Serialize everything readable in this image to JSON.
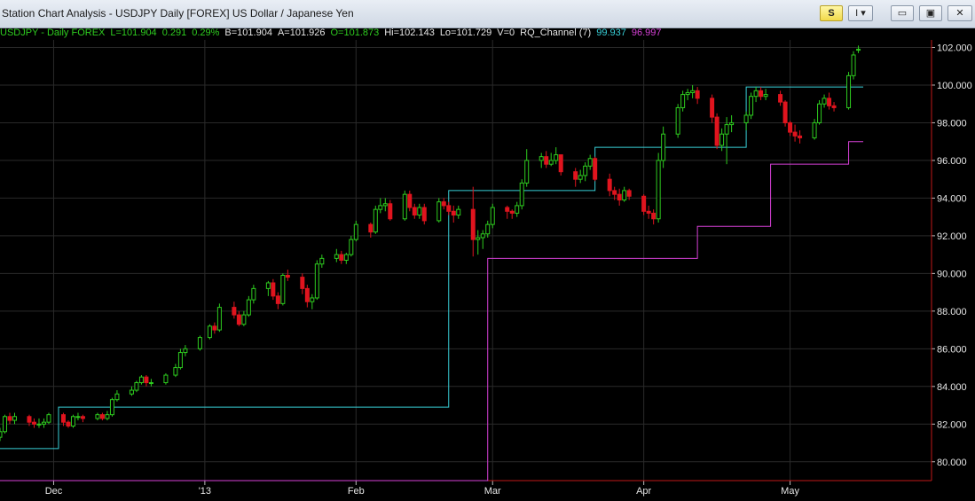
{
  "window": {
    "title": "Station Chart Analysis - USDJPY Daily [FOREX] US Dollar / Japanese Yen",
    "s_label": "S",
    "i_label": "I ▾",
    "min_label": "▭",
    "max_label": "▣",
    "close_label": "✕"
  },
  "legend": {
    "symbol": "USDJPY - Daily  FOREX",
    "last": "L=101.904",
    "change": "0.291",
    "pct": "0.29%",
    "bid": "B=101.904",
    "ask": "A=101.926",
    "open": "O=101.873",
    "high": "Hi=102.143",
    "low": "Lo=101.729",
    "vol": "V=0",
    "indicator": "RQ_Channel (7)",
    "upper_val": "99.937",
    "lower_val": "96.997"
  },
  "colors": {
    "up": "#2ecc1f",
    "down": "#e0141e",
    "upper": "#38d0d8",
    "lower": "#d640d6",
    "grid": "#2a2a2a",
    "axis": "#c01818"
  },
  "chart_data": {
    "type": "candlestick",
    "y_ticks": [
      "102.000",
      "100.000",
      "98.000",
      "96.000",
      "94.000",
      "92.000",
      "90.000",
      "88.000",
      "86.000",
      "84.000",
      "82.000",
      "80.000"
    ],
    "x_labels": [
      "Dec",
      "'13",
      "Feb",
      "Mar",
      "Apr",
      "May"
    ],
    "x_label_dates": [
      "2012-12-01",
      "2013-01-01",
      "2013-02-01",
      "2013-03-01",
      "2013-04-01",
      "2013-05-01"
    ],
    "x_range": [
      "2012-11-20",
      "2013-05-30"
    ],
    "ylim": [
      79.0,
      102.4
    ],
    "grid": true,
    "ohlc": [
      [
        "2012-11-20",
        81.3,
        81.8,
        81.1,
        81.6
      ],
      [
        "2012-11-21",
        81.6,
        82.5,
        81.5,
        82.4
      ],
      [
        "2012-11-22",
        82.4,
        82.6,
        82.0,
        82.2
      ],
      [
        "2012-11-23",
        82.2,
        82.6,
        82.0,
        82.4
      ],
      [
        "2012-11-26",
        82.4,
        82.5,
        81.9,
        82.1
      ],
      [
        "2012-11-27",
        82.1,
        82.3,
        81.8,
        82.0
      ],
      [
        "2012-11-28",
        82.0,
        82.3,
        81.8,
        82.0
      ],
      [
        "2012-11-29",
        82.0,
        82.3,
        81.8,
        82.1
      ],
      [
        "2012-11-30",
        82.1,
        82.6,
        82.0,
        82.5
      ],
      [
        "2012-12-03",
        82.5,
        82.6,
        81.9,
        82.1
      ],
      [
        "2012-12-04",
        82.1,
        82.2,
        81.8,
        81.9
      ],
      [
        "2012-12-05",
        81.9,
        82.5,
        81.8,
        82.4
      ],
      [
        "2012-12-06",
        82.4,
        82.6,
        82.2,
        82.4
      ],
      [
        "2012-12-07",
        82.4,
        82.5,
        82.1,
        82.3
      ],
      [
        "2012-12-10",
        82.3,
        82.6,
        82.2,
        82.5
      ],
      [
        "2012-12-11",
        82.5,
        82.6,
        82.2,
        82.3
      ],
      [
        "2012-12-12",
        82.3,
        82.7,
        82.2,
        82.5
      ],
      [
        "2012-12-13",
        82.5,
        83.4,
        82.4,
        83.3
      ],
      [
        "2012-12-14",
        83.3,
        83.8,
        83.2,
        83.6
      ],
      [
        "2012-12-17",
        83.6,
        84.0,
        83.5,
        83.8
      ],
      [
        "2012-12-18",
        83.8,
        84.3,
        83.7,
        84.2
      ],
      [
        "2012-12-19",
        84.2,
        84.6,
        84.1,
        84.5
      ],
      [
        "2012-12-20",
        84.5,
        84.6,
        84.0,
        84.2
      ],
      [
        "2012-12-21",
        84.2,
        84.4,
        84.0,
        84.2
      ],
      [
        "2012-12-24",
        84.2,
        84.7,
        84.1,
        84.6
      ],
      [
        "2012-12-26",
        84.6,
        85.2,
        84.5,
        85.0
      ],
      [
        "2012-12-27",
        85.0,
        86.0,
        84.9,
        85.8
      ],
      [
        "2012-12-28",
        85.8,
        86.2,
        85.6,
        86.0
      ],
      [
        "2012-12-31",
        86.0,
        86.7,
        85.9,
        86.6
      ],
      [
        "2013-01-02",
        86.6,
        87.3,
        86.5,
        87.2
      ],
      [
        "2013-01-03",
        87.2,
        87.4,
        86.8,
        87.0
      ],
      [
        "2013-01-04",
        87.0,
        88.4,
        86.9,
        88.2
      ],
      [
        "2013-01-07",
        88.2,
        88.5,
        87.6,
        87.8
      ],
      [
        "2013-01-08",
        87.8,
        88.0,
        87.2,
        87.3
      ],
      [
        "2013-01-09",
        87.3,
        88.0,
        87.2,
        87.8
      ],
      [
        "2013-01-10",
        87.8,
        88.8,
        87.7,
        88.6
      ],
      [
        "2013-01-11",
        88.6,
        89.4,
        88.4,
        89.2
      ],
      [
        "2013-01-14",
        89.2,
        89.6,
        88.8,
        89.5
      ],
      [
        "2013-01-15",
        89.5,
        89.7,
        88.6,
        88.8
      ],
      [
        "2013-01-16",
        88.8,
        89.0,
        88.1,
        88.4
      ],
      [
        "2013-01-17",
        88.4,
        90.0,
        88.3,
        89.9
      ],
      [
        "2013-01-18",
        89.9,
        90.2,
        89.6,
        89.8
      ],
      [
        "2013-01-21",
        89.8,
        90.0,
        88.9,
        89.2
      ],
      [
        "2013-01-22",
        89.2,
        89.4,
        88.2,
        88.5
      ],
      [
        "2013-01-23",
        88.5,
        88.9,
        88.1,
        88.7
      ],
      [
        "2013-01-24",
        88.7,
        90.7,
        88.6,
        90.5
      ],
      [
        "2013-01-25",
        90.5,
        91.0,
        90.3,
        90.8
      ],
      [
        "2013-01-28",
        90.8,
        91.3,
        90.6,
        91.0
      ],
      [
        "2013-01-29",
        91.0,
        91.2,
        90.5,
        90.7
      ],
      [
        "2013-01-30",
        90.7,
        91.1,
        90.5,
        91.0
      ],
      [
        "2013-01-31",
        91.0,
        92.0,
        90.9,
        91.8
      ],
      [
        "2013-02-01",
        91.8,
        92.8,
        91.7,
        92.6
      ],
      [
        "2013-02-04",
        92.6,
        92.7,
        91.9,
        92.2
      ],
      [
        "2013-02-05",
        92.2,
        93.6,
        92.1,
        93.4
      ],
      [
        "2013-02-06",
        93.4,
        94.0,
        93.2,
        93.6
      ],
      [
        "2013-02-07",
        93.6,
        94.0,
        93.3,
        93.7
      ],
      [
        "2013-02-08",
        93.7,
        93.9,
        92.8,
        92.9
      ],
      [
        "2013-02-11",
        92.9,
        94.4,
        92.8,
        94.2
      ],
      [
        "2013-02-12",
        94.2,
        94.4,
        93.3,
        93.5
      ],
      [
        "2013-02-13",
        93.5,
        93.7,
        92.9,
        93.1
      ],
      [
        "2013-02-14",
        93.1,
        93.7,
        92.9,
        93.5
      ],
      [
        "2013-02-15",
        93.5,
        93.7,
        92.6,
        92.8
      ],
      [
        "2013-02-18",
        92.8,
        94.0,
        92.7,
        93.8
      ],
      [
        "2013-02-19",
        93.8,
        94.0,
        93.4,
        93.6
      ],
      [
        "2013-02-20",
        93.6,
        93.8,
        93.1,
        93.3
      ],
      [
        "2013-02-21",
        93.3,
        93.6,
        92.7,
        93.1
      ],
      [
        "2013-02-22",
        93.1,
        93.6,
        92.9,
        93.4
      ],
      [
        "2013-02-25",
        93.4,
        94.6,
        90.9,
        91.8
      ],
      [
        "2013-02-26",
        91.8,
        92.3,
        91.0,
        91.9
      ],
      [
        "2013-02-27",
        91.9,
        92.3,
        91.3,
        92.1
      ],
      [
        "2013-02-28",
        92.1,
        92.8,
        91.9,
        92.6
      ],
      [
        "2013-03-01",
        92.6,
        93.7,
        92.4,
        93.5
      ],
      [
        "2013-03-04",
        93.5,
        93.6,
        92.9,
        93.3
      ],
      [
        "2013-03-05",
        93.3,
        93.4,
        92.9,
        93.2
      ],
      [
        "2013-03-06",
        93.2,
        93.8,
        93.0,
        93.6
      ],
      [
        "2013-03-07",
        93.6,
        95.0,
        93.4,
        94.8
      ],
      [
        "2013-03-08",
        94.8,
        96.6,
        94.6,
        96.0
      ],
      [
        "2013-03-11",
        96.0,
        96.4,
        95.6,
        96.2
      ],
      [
        "2013-03-12",
        96.2,
        96.5,
        95.6,
        95.8
      ],
      [
        "2013-03-13",
        95.8,
        96.4,
        95.7,
        96.0
      ],
      [
        "2013-03-14",
        96.0,
        96.7,
        95.8,
        96.3
      ],
      [
        "2013-03-15",
        96.3,
        96.3,
        95.2,
        95.4
      ],
      [
        "2013-03-18",
        95.4,
        95.6,
        94.6,
        95.0
      ],
      [
        "2013-03-19",
        95.0,
        95.5,
        94.8,
        95.2
      ],
      [
        "2013-03-20",
        95.2,
        95.9,
        94.9,
        95.7
      ],
      [
        "2013-03-21",
        95.7,
        96.3,
        95.5,
        96.1
      ],
      [
        "2013-03-22",
        96.1,
        96.2,
        94.9,
        95.0
      ],
      [
        "2013-03-25",
        95.0,
        95.3,
        94.1,
        94.4
      ],
      [
        "2013-03-26",
        94.4,
        94.6,
        93.9,
        94.2
      ],
      [
        "2013-03-27",
        94.2,
        94.5,
        93.6,
        93.9
      ],
      [
        "2013-03-28",
        93.9,
        94.6,
        93.8,
        94.4
      ],
      [
        "2013-03-29",
        94.4,
        94.5,
        93.9,
        94.1
      ],
      [
        "2013-04-01",
        94.1,
        94.2,
        93.1,
        93.3
      ],
      [
        "2013-04-02",
        93.3,
        93.6,
        92.9,
        93.2
      ],
      [
        "2013-04-03",
        93.2,
        93.4,
        92.6,
        92.9
      ],
      [
        "2013-04-04",
        92.9,
        96.4,
        92.7,
        96.0
      ],
      [
        "2013-04-05",
        96.0,
        97.8,
        95.6,
        97.4
      ],
      [
        "2013-04-08",
        97.4,
        99.0,
        97.2,
        98.8
      ],
      [
        "2013-04-09",
        98.8,
        99.7,
        98.6,
        99.5
      ],
      [
        "2013-04-10",
        99.5,
        99.8,
        99.2,
        99.6
      ],
      [
        "2013-04-11",
        99.6,
        100.0,
        99.3,
        99.7
      ],
      [
        "2013-04-12",
        99.7,
        99.9,
        99.0,
        99.3
      ],
      [
        "2013-04-15",
        99.3,
        99.5,
        98.0,
        98.3
      ],
      [
        "2013-04-16",
        98.3,
        98.5,
        96.6,
        96.8
      ],
      [
        "2013-04-17",
        96.8,
        97.7,
        96.5,
        97.4
      ],
      [
        "2013-04-18",
        97.4,
        98.3,
        95.8,
        97.9
      ],
      [
        "2013-04-19",
        97.9,
        98.4,
        97.5,
        98.0
      ],
      [
        "2013-04-22",
        98.0,
        98.6,
        97.6,
        98.4
      ],
      [
        "2013-04-23",
        98.4,
        99.6,
        98.2,
        99.4
      ],
      [
        "2013-04-24",
        99.4,
        99.9,
        99.1,
        99.7
      ],
      [
        "2013-04-25",
        99.7,
        99.9,
        99.2,
        99.4
      ],
      [
        "2013-04-26",
        99.4,
        99.8,
        99.2,
        99.5
      ],
      [
        "2013-04-29",
        99.5,
        99.7,
        98.9,
        99.1
      ],
      [
        "2013-04-30",
        99.1,
        99.2,
        97.8,
        98.0
      ],
      [
        "2013-05-01",
        98.0,
        98.1,
        97.3,
        97.5
      ],
      [
        "2013-05-02",
        97.5,
        97.9,
        97.0,
        97.3
      ],
      [
        "2013-05-03",
        97.3,
        97.6,
        96.9,
        97.2
      ],
      [
        "2013-05-06",
        97.2,
        98.2,
        97.1,
        98.0
      ],
      [
        "2013-05-07",
        98.0,
        99.2,
        97.9,
        99.0
      ],
      [
        "2013-05-08",
        99.0,
        99.5,
        98.8,
        99.3
      ],
      [
        "2013-05-09",
        99.3,
        99.6,
        98.7,
        98.9
      ],
      [
        "2013-05-10",
        98.9,
        99.1,
        98.6,
        98.8
      ],
      [
        "2013-05-13",
        98.8,
        100.7,
        98.7,
        100.5
      ],
      [
        "2013-05-14",
        100.5,
        101.8,
        100.3,
        101.6
      ],
      [
        "2013-05-15",
        101.9,
        102.1,
        101.7,
        101.9
      ]
    ],
    "series": [
      {
        "name": "RQ_Channel (7)",
        "steps": [
          [
            "2012-11-20",
            80.7
          ],
          [
            "2012-12-02",
            82.9
          ],
          [
            "2013-02-20",
            94.4
          ],
          [
            "2013-03-22",
            96.7
          ],
          [
            "2013-04-22",
            99.9
          ],
          [
            "2013-05-16",
            99.9
          ]
        ]
      },
      {
        "steps": [
          [
            "2012-11-20",
            79.0
          ],
          [
            "2013-02-28",
            90.8
          ],
          [
            "2013-04-12",
            92.5
          ],
          [
            "2013-04-27",
            95.8
          ],
          [
            "2013-05-13",
            97.0
          ],
          [
            "2013-05-16",
            97.0
          ]
        ]
      }
    ]
  }
}
